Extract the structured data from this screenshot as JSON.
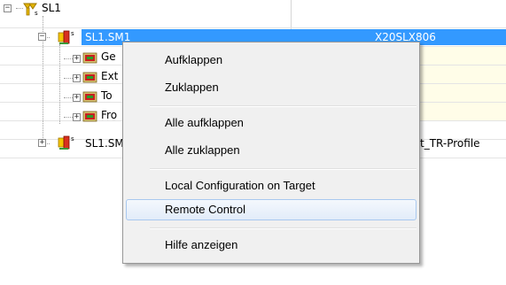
{
  "tree": {
    "root_label": "SL1",
    "selected_label": "SL1.SM1",
    "selected_value": "X20SLX806",
    "children": [
      {
        "label": "Ge",
        "value": ""
      },
      {
        "label": "Ext",
        "value": ""
      },
      {
        "label": "To",
        "value": ""
      },
      {
        "label": "Fro",
        "value": ""
      }
    ],
    "sibling_label": "SL1.SM",
    "sibling_value": "t_TR-Profile",
    "expander_minus": "−",
    "expander_plus": "+"
  },
  "context_menu": {
    "items": [
      {
        "label": "Aufklappen"
      },
      {
        "label": "Zuklappen"
      },
      {
        "label": "Alle aufklappen"
      },
      {
        "label": "Alle zuklappen"
      },
      {
        "label": "Local Configuration on Target"
      },
      {
        "label": "Remote Control",
        "hover": true
      },
      {
        "label": "Hilfe anzeigen"
      }
    ]
  },
  "colors": {
    "selection": "#3399ff",
    "row_alt": "#fffde8",
    "menu_bg": "#f0f0f0",
    "hover_border": "#a8c8ef"
  }
}
